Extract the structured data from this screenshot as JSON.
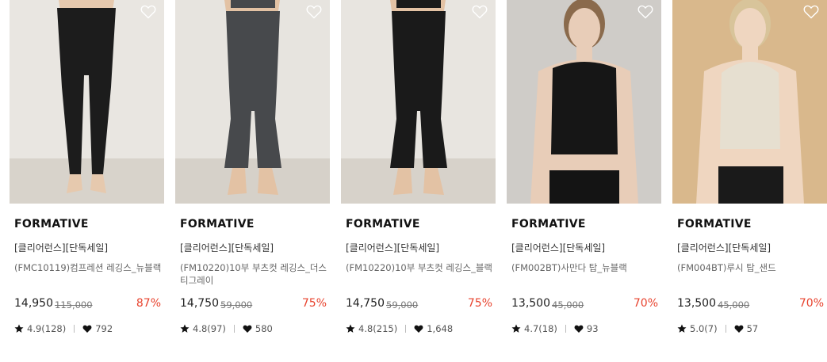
{
  "products": [
    {
      "brand": "FORMATIVE",
      "tag": "[클리어런스][단독세일]",
      "name": "(FMC10119)컴프레션 레깅스_뉴블랙",
      "price": "14,950",
      "original_price": "115,000",
      "discount": "87%",
      "rating": "4.9(128)",
      "likes": "792",
      "image": {
        "bg": "#e9e6e1",
        "floor": "#d8d3cb",
        "garment": "#1c1c1c",
        "skin": "#e6c9ae",
        "type": "leggings"
      }
    },
    {
      "brand": "FORMATIVE",
      "tag": "[클리어런스][단독세일]",
      "name": "(FM10220)10부 부츠컷 레깅스_더스티그레이",
      "price": "14,750",
      "original_price": "59,000",
      "discount": "75%",
      "rating": "4.8(97)",
      "likes": "580",
      "image": {
        "bg": "#e7e4df",
        "floor": "#d6d1c9",
        "garment": "#47494c",
        "skin": "#e3c2a4",
        "type": "bootcut"
      }
    },
    {
      "brand": "FORMATIVE",
      "tag": "[클리어런스][단독세일]",
      "name": "(FM10220)10부 부츠컷 레깅스_블랙",
      "price": "14,750",
      "original_price": "59,000",
      "discount": "75%",
      "rating": "4.8(215)",
      "likes": "1,648",
      "image": {
        "bg": "#e8e5e0",
        "floor": "#d7d2ca",
        "garment": "#1a1a1a",
        "skin": "#e3c2a4",
        "type": "bootcut"
      }
    },
    {
      "brand": "FORMATIVE",
      "tag": "[클리어런스][단독세일]",
      "name": "(FM002BT)사만다 탑_뉴블랙",
      "price": "13,500",
      "original_price": "45,000",
      "discount": "70%",
      "rating": "4.7(18)",
      "likes": "93",
      "image": {
        "bg": "#cfccc8",
        "floor": "#cfccc8",
        "garment": "#161616",
        "skin": "#e8cdb8",
        "hair": "#8a6a4c",
        "type": "top-dark"
      }
    },
    {
      "brand": "FORMATIVE",
      "tag": "[클리어런스][단독세일]",
      "name": "(FM004BT)루시 탑_샌드",
      "price": "13,500",
      "original_price": "45,000",
      "discount": "70%",
      "rating": "5.0(7)",
      "likes": "57",
      "image": {
        "bg": "#d9b88c",
        "floor": "#d9b88c",
        "garment": "#e6dfd0",
        "skin": "#efd6c0",
        "hair": "#d8c49a",
        "type": "top-light"
      }
    }
  ]
}
